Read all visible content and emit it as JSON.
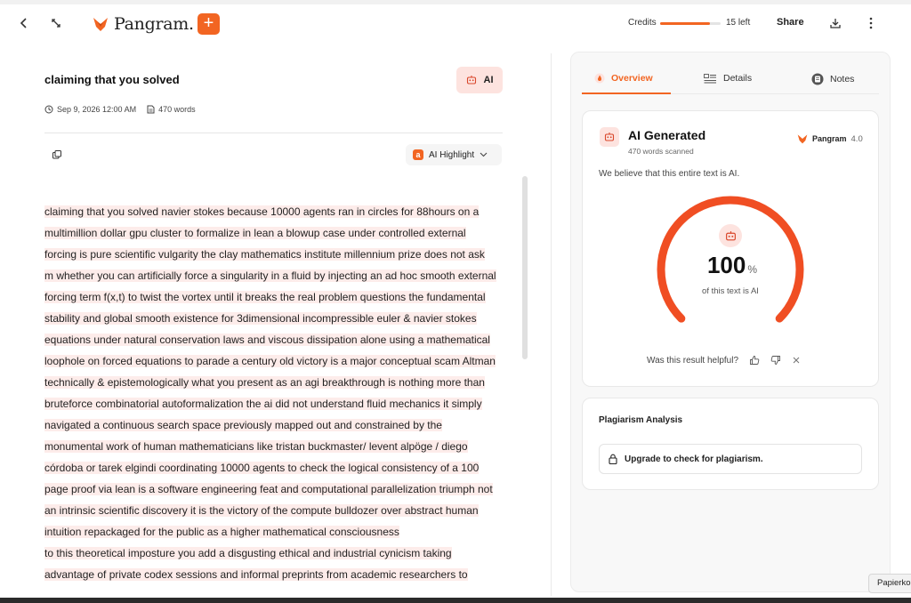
{
  "header": {
    "logo_text": "Pangram.",
    "plus_label": "+",
    "credits_label": "Credits",
    "credits_fraction": 0.82,
    "credits_left": "15 left",
    "share_label": "Share"
  },
  "document": {
    "title": "claiming that you solved",
    "ai_badge": "AI",
    "date": "Sep 9, 2026 12:00 AM",
    "word_count": "470 words",
    "highlight_button": "AI Highlight",
    "highlight_icon_letter": "a",
    "lines": [
      "claiming that you solved navier stokes because 10000 agents ran in circles for 88hours on a",
      "multimillion dollar gpu cluster to formalize in lean a blowup case under controlled external",
      "forcing is pure scientific vulgarity the clay mathematics institute millennium prize does not ask",
      "m whether you can artificially force a singularity in a fluid by injecting an ad hoc smooth external",
      "forcing term f(x,t) to twist the vortex until it breaks the real problem questions the fundamental",
      "stability and global smooth existence for 3dimensional incompressible euler & navier stokes",
      "equations under natural conservation laws and viscous dissipation alone using a mathematical",
      "loophole on forced equations to parade a century old victory is a major conceptual scam Altman",
      "technically & epistemologically what you present as an agi breakthrough is nothing more than",
      "bruteforce combinatorial autoformalization the ai did not understand fluid mechanics it simply",
      "navigated a continuous search space previously mapped out and constrained by the",
      "monumental work of human mathematicians like tristan buckmaster/ levent alpöge / diego",
      "córdoba or tarek elgindi coordinating 10000 agents to check the logical consistency of a 100",
      "page proof via lean is a software engineering feat and computational parallelization triumph not",
      "an intrinsic scientific discovery it is the victory of the compute bulldozer over abstract human",
      "intuition repackaged for the public as a higher mathematical consciousness",
      "to this theoretical imposture you add a disgusting ethical and industrial cynicism taking",
      "advantage of private codex sessions and informal preprints from academic researchers to",
      ""
    ]
  },
  "panel": {
    "tabs": [
      {
        "label": "Overview",
        "icon": "flame-icon"
      },
      {
        "label": "Details",
        "icon": "list-icon"
      },
      {
        "label": "Notes",
        "icon": "notes-icon"
      }
    ],
    "result": {
      "title": "AI Generated",
      "words_scanned": "470 words scanned",
      "brand": "Pangram",
      "version": "4.0",
      "statement": "We believe that this entire text is AI.",
      "value": "100",
      "unit": "%",
      "value_label": "of this text is AI",
      "gauge_fraction": 1.0,
      "helpful_question": "Was this result helpful?"
    },
    "plagiarism": {
      "title": "Plagiarism Analysis",
      "upgrade": "Upgrade to check for plagiarism."
    }
  },
  "tooltip": "Papierko",
  "colors": {
    "accent": "#f26522",
    "highlight": "#fdecea",
    "badge_bg": "#fde3df"
  }
}
